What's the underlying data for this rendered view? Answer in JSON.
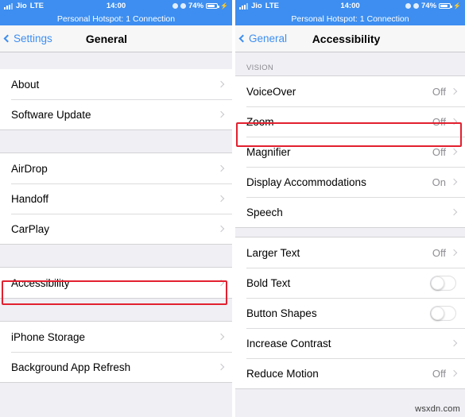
{
  "status_bar": {
    "carrier": "Jio",
    "network": "LTE",
    "time": "14:00",
    "battery_percent": "74%",
    "icons": [
      "signal-bars-icon",
      "location-arrow-icon",
      "alarm-clock-icon",
      "battery-icon",
      "charging-bolt-icon"
    ]
  },
  "hotspot_banner": {
    "text": "Personal Hotspot: 1 Connection"
  },
  "colors": {
    "status_bar_blue": "#3d8ef0",
    "highlight_red": "#e2202f",
    "tint_blue": "#3d8ef0",
    "value_gray": "#8e8e93",
    "background_gray": "#efeff4"
  },
  "left_panel": {
    "nav": {
      "back_label": "Settings",
      "title": "General"
    },
    "groups": [
      {
        "rows": [
          {
            "label": "About",
            "value": "",
            "accessory": "chevron"
          },
          {
            "label": "Software Update",
            "value": "",
            "accessory": "chevron"
          }
        ]
      },
      {
        "rows": [
          {
            "label": "AirDrop",
            "value": "",
            "accessory": "chevron"
          },
          {
            "label": "Handoff",
            "value": "",
            "accessory": "chevron"
          },
          {
            "label": "CarPlay",
            "value": "",
            "accessory": "chevron"
          }
        ]
      },
      {
        "rows": [
          {
            "label": "Accessibility",
            "value": "",
            "accessory": "chevron",
            "highlighted": true
          }
        ]
      },
      {
        "rows": [
          {
            "label": "iPhone Storage",
            "value": "",
            "accessory": "chevron"
          },
          {
            "label": "Background App Refresh",
            "value": "",
            "accessory": "chevron"
          }
        ]
      }
    ]
  },
  "right_panel": {
    "nav": {
      "back_label": "General",
      "title": "Accessibility"
    },
    "section_header": "VISION",
    "groups": [
      {
        "rows": [
          {
            "label": "VoiceOver",
            "value": "Off",
            "accessory": "chevron"
          },
          {
            "label": "Zoom",
            "value": "Off",
            "accessory": "chevron",
            "highlighted": true
          },
          {
            "label": "Magnifier",
            "value": "Off",
            "accessory": "chevron"
          },
          {
            "label": "Display Accommodations",
            "value": "On",
            "accessory": "chevron"
          },
          {
            "label": "Speech",
            "value": "",
            "accessory": "chevron"
          }
        ]
      },
      {
        "rows": [
          {
            "label": "Larger Text",
            "value": "Off",
            "accessory": "chevron"
          },
          {
            "label": "Bold Text",
            "value": "",
            "accessory": "toggle",
            "toggle_on": false
          },
          {
            "label": "Button Shapes",
            "value": "",
            "accessory": "toggle",
            "toggle_on": false
          },
          {
            "label": "Increase Contrast",
            "value": "",
            "accessory": "chevron"
          },
          {
            "label": "Reduce Motion",
            "value": "Off",
            "accessory": "chevron"
          }
        ]
      }
    ]
  },
  "watermark": {
    "text": "wsxdn.com"
  }
}
